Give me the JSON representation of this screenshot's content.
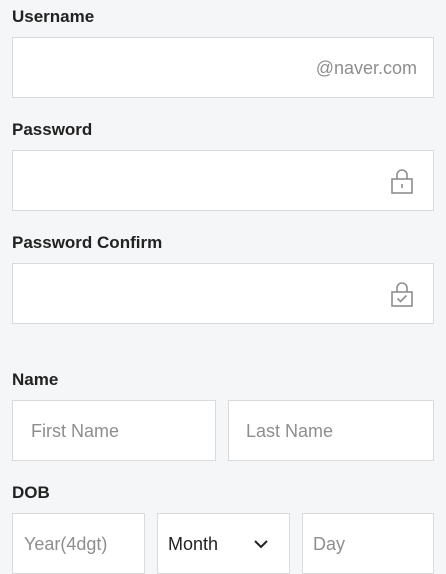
{
  "username": {
    "label": "Username",
    "suffix": "@naver.com"
  },
  "password": {
    "label": "Password",
    "icon": "lock-icon"
  },
  "password_confirm": {
    "label": "Password Confirm",
    "icon": "lock-check-icon"
  },
  "name": {
    "label": "Name",
    "first_placeholder": "First Name",
    "last_placeholder": "Last Name"
  },
  "dob": {
    "label": "DOB",
    "year_placeholder": "Year(4dgt)",
    "month_value": "Month",
    "day_placeholder": "Day",
    "month_icon": "chevron-down-icon"
  }
}
